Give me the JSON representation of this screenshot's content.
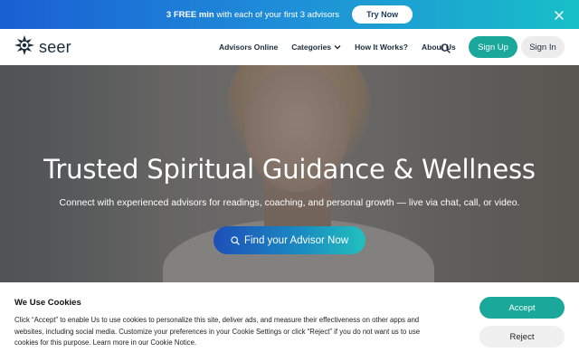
{
  "promo": {
    "highlight": "3 FREE min",
    "text": " with each of your first 3 advisors",
    "button_label": "Try Now",
    "close_icon": "close-icon"
  },
  "nav": {
    "logo_text": "seer",
    "links": [
      "Advisors Online",
      "Categories",
      "How It Works?",
      "About Us"
    ],
    "signup_label": "Sign Up",
    "signin_label": "Sign In"
  },
  "hero": {
    "title": "Trusted Spiritual Guidance & Wellness",
    "subtitle": "Connect with experienced advisors for readings, coaching, and personal growth — live via chat, call, or video.",
    "cta_label": "Find your Advisor Now"
  },
  "cookie": {
    "title": "We Use Cookies",
    "text": "Click “Accept” to enable Us to use cookies to personalize this site, deliver ads, and measure their effectiveness on other apps and websites, including social media. Customize your preferences in your Cookie Settings or click “Reject” if you do not want us to use cookies for this purpose. Learn more in our Cookie Notice.",
    "accept_label": "Accept",
    "reject_label": "Reject"
  },
  "colors": {
    "accent_teal": "#1aa89a",
    "promo_blue": "#1a5fd4"
  }
}
